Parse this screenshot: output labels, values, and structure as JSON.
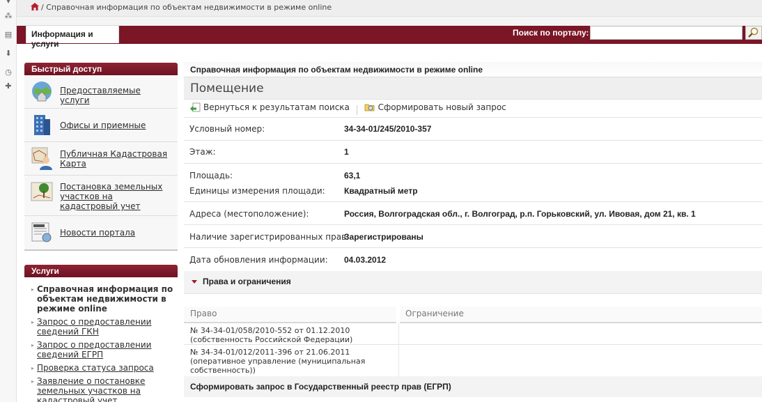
{
  "breadcrumb": {
    "text": "/ Справочная информация по объектам недвижимости в режиме online"
  },
  "topbar": {
    "tab_label": "Информация и услуги",
    "search_label": "Поиск по порталу:",
    "search_value": ""
  },
  "sidebar": {
    "quick_header": "Быстрый доступ",
    "quick_items": [
      {
        "label": "Предоставляемые услуги",
        "icon": "globe-house-icon"
      },
      {
        "label": "Офисы и приемные",
        "icon": "office-building-icon"
      },
      {
        "label": "Публичная Кадастровая Карта",
        "icon": "cadastral-map-icon"
      },
      {
        "label": "Постановка земельных участков на кадастровый учет",
        "icon": "land-plot-icon"
      },
      {
        "label": "Новости портала",
        "icon": "news-icon"
      }
    ],
    "services_header": "Услуги",
    "services": [
      {
        "label": "Справочная информация по объектам недвижимости в режиме online",
        "active": true
      },
      {
        "label": "Запрос о предоставлении сведений ГКН",
        "active": false
      },
      {
        "label": "Запрос о предоставлении сведений ЕГРП",
        "active": false
      },
      {
        "label": "Проверка статуса запроса",
        "active": false
      },
      {
        "label": "Заявление о постановке земельных участков на кадастровый учет",
        "active": false
      }
    ]
  },
  "main": {
    "title": "Справочная информация по объектам недвижимости в режиме online",
    "section_title": "Помещение",
    "actions": {
      "back": "Вернуться к результатам поиска",
      "new_request": "Сформировать новый запрос"
    },
    "fields": [
      {
        "label": "Условный номер:",
        "value": "34-34-01/245/2010-357"
      },
      {
        "label": "Этаж:",
        "value": "1"
      },
      {
        "label": "Площадь:",
        "value": "63,1"
      },
      {
        "label": "Единицы измерения площади:",
        "value": "Квадратный метр"
      },
      {
        "label": "Адреса (местоположение):",
        "value": "Россия, Волгоградская обл., г. Волгоград, р.п. Горьковский, ул. Ивовая, дом 21, кв. 1"
      },
      {
        "label": "Наличие зарегистрированных прав:",
        "value": "Зарегистрированы"
      },
      {
        "label": "Дата обновления информации:",
        "value": "04.03.2012"
      }
    ],
    "rights": {
      "header": "Права и ограничения",
      "col_right": "Право",
      "col_restriction": "Ограничение",
      "rows": [
        {
          "right_line1": "№ 34-34-01/058/2010-552  от 01.12.2010",
          "right_line2": " (собственность Российской Федерации)",
          "right_line3": ""
        },
        {
          "right_line1": "№ 34-34-01/012/2011-396  от 21.06.2011",
          "right_line2": " (оперативное управление (муниципальная",
          "right_line3": "собственность))"
        }
      ]
    },
    "footer_action": "Сформировать запрос в Государственный реестр прав (ЕГРП)"
  }
}
